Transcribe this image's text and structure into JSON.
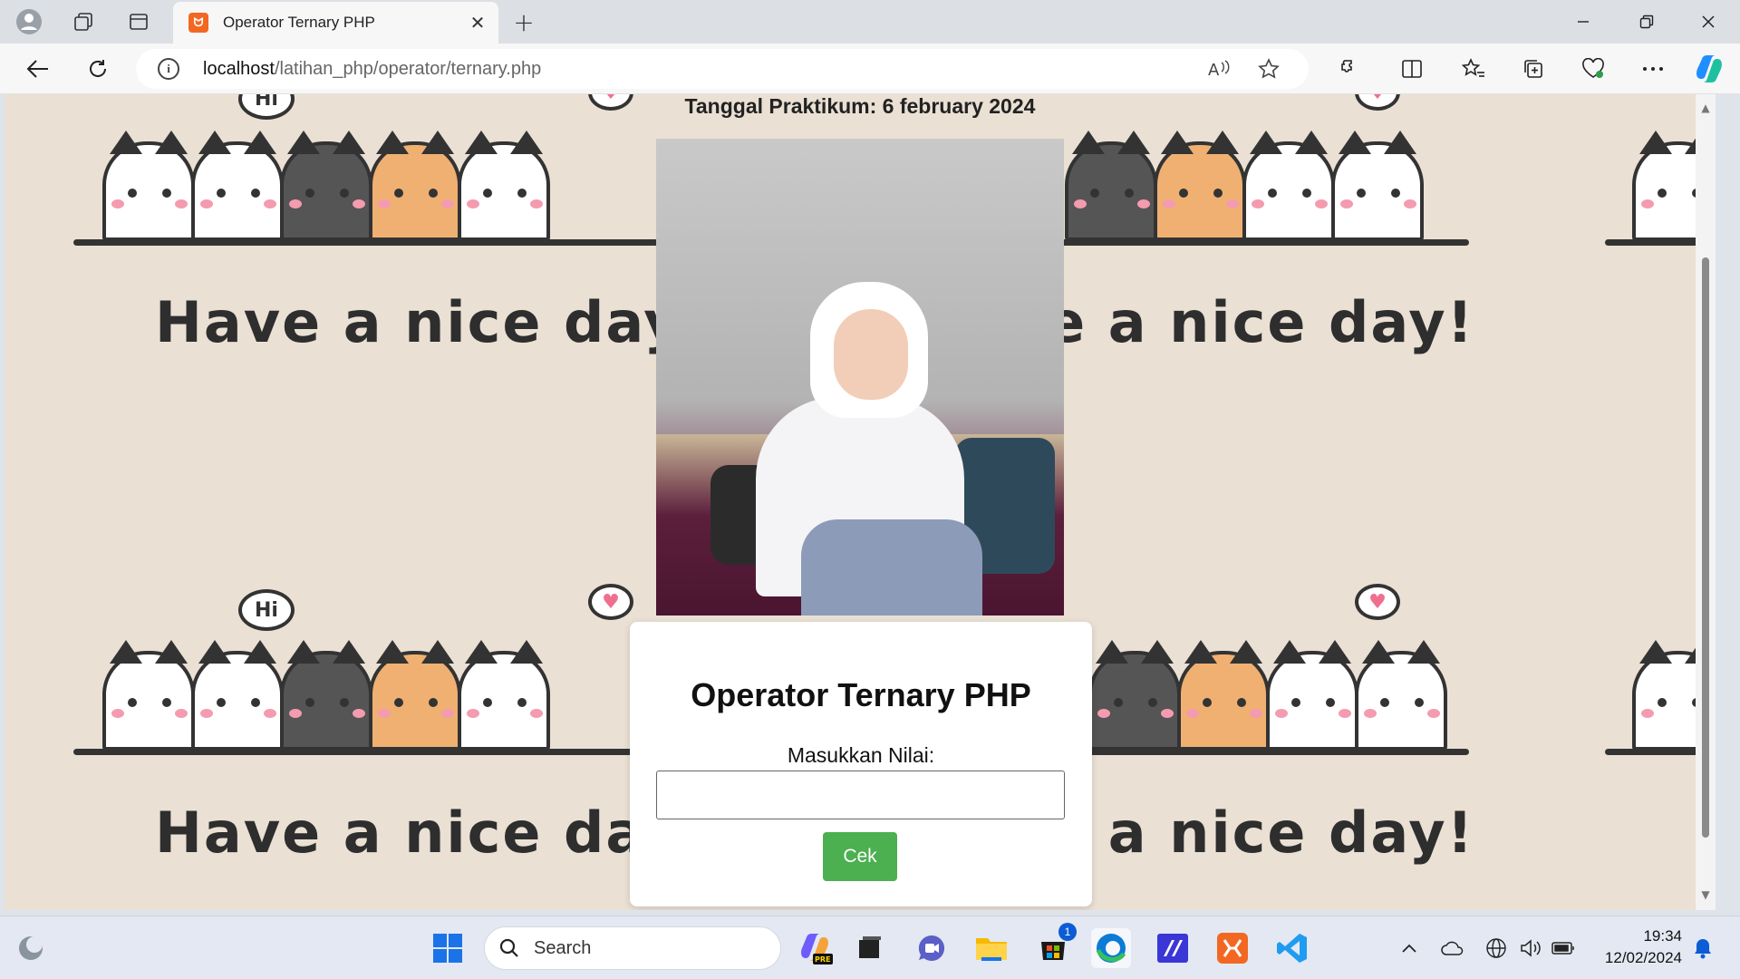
{
  "browser": {
    "tab_title": "Operator Ternary PHP",
    "tab_favicon": "xampp-icon",
    "url_host": "localhost",
    "url_path": "/latihan_php/operator/ternary.php",
    "new_tab": "+",
    "close_tab": "✕"
  },
  "page": {
    "date_text": "Tanggal Praktikum: 6 february 2024",
    "background_text": "Have a nice day!",
    "bubble_hi": "Hi",
    "card_title": "Operator Ternary PHP",
    "input_label": "Masukkan Nilai:",
    "input_value": "",
    "button_label": "Cek",
    "button_color": "#4caf50",
    "background_color": "#eae0d4"
  },
  "taskbar": {
    "search_placeholder": "Search",
    "store_badge": "1",
    "time": "19:34",
    "date": "12/02/2024",
    "copilot_badge": "PRE"
  }
}
